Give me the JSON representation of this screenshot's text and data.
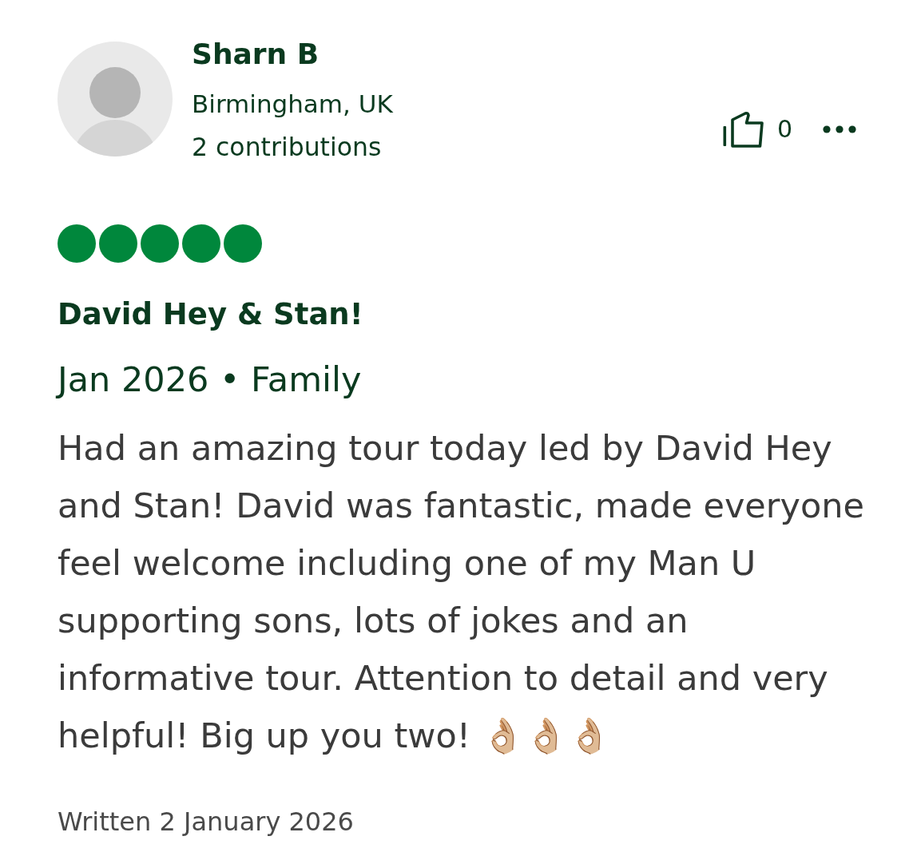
{
  "reviewer": {
    "name": "Sharn B",
    "location": "Birmingham, UK",
    "contributions": "2 contributions"
  },
  "actions": {
    "helpful_count": "0"
  },
  "review": {
    "rating": {
      "stars": 5
    },
    "title": "David Hey & Stan!",
    "meta": "Jan 2026 • Family",
    "body": "Had an amazing tour today led by David Hey and Stan! David was fantastic, made everyone feel welcome including one of my Man U supporting sons, lots of jokes and an informative tour. Attention to detail and very helpful! Big up you two! 👌🏼👌🏼👌🏼",
    "written": "Written 2 January 2026"
  }
}
